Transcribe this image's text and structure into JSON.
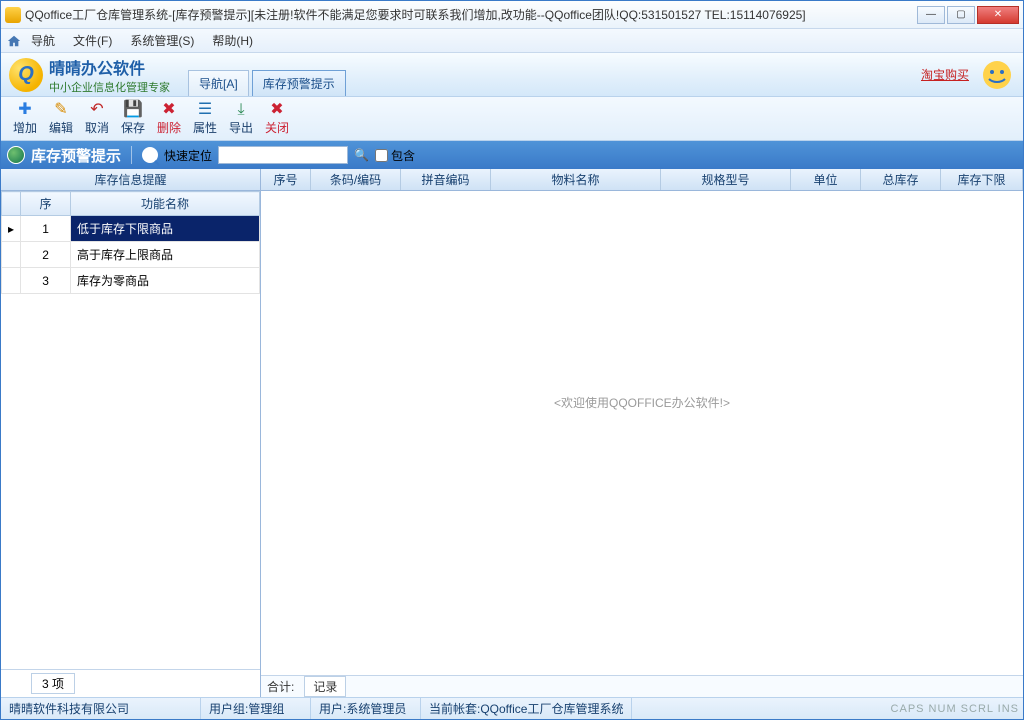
{
  "window": {
    "title": "QQoffice工厂仓库管理系统-[库存预警提示][未注册!软件不能满足您要求时可联系我们增加,改功能--QQoffice团队!QQ:531501527 TEL:15114076925]"
  },
  "menu": {
    "nav": "导航",
    "file": "文件(F)",
    "system": "系统管理(S)",
    "help": "帮助(H)"
  },
  "brand": {
    "title": "晴晴办公软件",
    "subtitle": "中小企业信息化管理专家",
    "link": "淘宝购买"
  },
  "tabs": {
    "nav": "导航[A]",
    "alert": "库存预警提示"
  },
  "toolbar": {
    "add": "增加",
    "edit": "编辑",
    "cancel": "取消",
    "save": "保存",
    "delete": "删除",
    "prop": "属性",
    "export": "导出",
    "close": "关闭"
  },
  "subbar": {
    "title": "库存预警提示",
    "quick": "快速定位",
    "search_ph": "",
    "contain": "包含"
  },
  "left": {
    "header": "库存信息提醒",
    "col_seq": "序",
    "col_name": "功能名称",
    "rows": [
      {
        "seq": "1",
        "name": "低于库存下限商品"
      },
      {
        "seq": "2",
        "name": "高于库存上限商品"
      },
      {
        "seq": "3",
        "name": "库存为零商品"
      }
    ],
    "count": "3 项"
  },
  "grid": {
    "cols": {
      "seq": "序号",
      "barcode": "条码/编码",
      "pinyin": "拼音编码",
      "material": "物料名称",
      "spec": "规格型号",
      "unit": "单位",
      "total": "总库存",
      "lower": "库存下限"
    },
    "placeholder": "<欢迎使用QQOFFICE办公软件!>",
    "sum": "合计:",
    "records": "记录"
  },
  "status": {
    "company": "晴晴软件科技有限公司",
    "group_lbl": "用户组:",
    "group": "管理组",
    "user_lbl": "用户:",
    "user": "系统管理员",
    "acct_lbl": "当前帐套:",
    "acct": "QQoffice工厂仓库管理系统",
    "ind": "CAPS NUM SCRL INS"
  }
}
